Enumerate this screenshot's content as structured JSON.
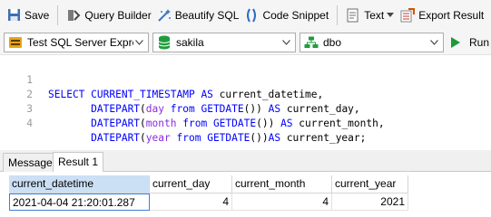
{
  "toolbar": {
    "save_label": "Save",
    "query_builder_label": "Query Builder",
    "beautify_label": "Beautify SQL",
    "code_snippet_label": "Code Snippet",
    "text_label": "Text",
    "export_label": "Export Result"
  },
  "connection": {
    "server": "Test SQL Server Expres",
    "database": "sakila",
    "schema": "dbo",
    "run_label": "Run"
  },
  "editor": {
    "lines": [
      {
        "number": "1"
      },
      {
        "number": "2"
      },
      {
        "number": "3"
      },
      {
        "number": "4"
      }
    ]
  },
  "tabs": {
    "message": "Message",
    "result": "Result 1"
  },
  "grid": {
    "columns": [
      "current_datetime",
      "current_day",
      "current_month",
      "current_year"
    ],
    "rows": [
      [
        "2021-04-04 21:20:01.287",
        "4",
        "4",
        "2021"
      ]
    ]
  },
  "colors": {
    "keyword": "#0000ff",
    "datepart": "#8a2be2",
    "run_green": "#1a9a3c",
    "header_selected": "#cce0f5"
  },
  "icons": [
    "save-icon",
    "query-builder-icon",
    "beautify-icon",
    "code-snippet-icon",
    "text-icon",
    "export-icon",
    "server-icon",
    "database-icon",
    "schema-icon",
    "run-icon"
  ]
}
